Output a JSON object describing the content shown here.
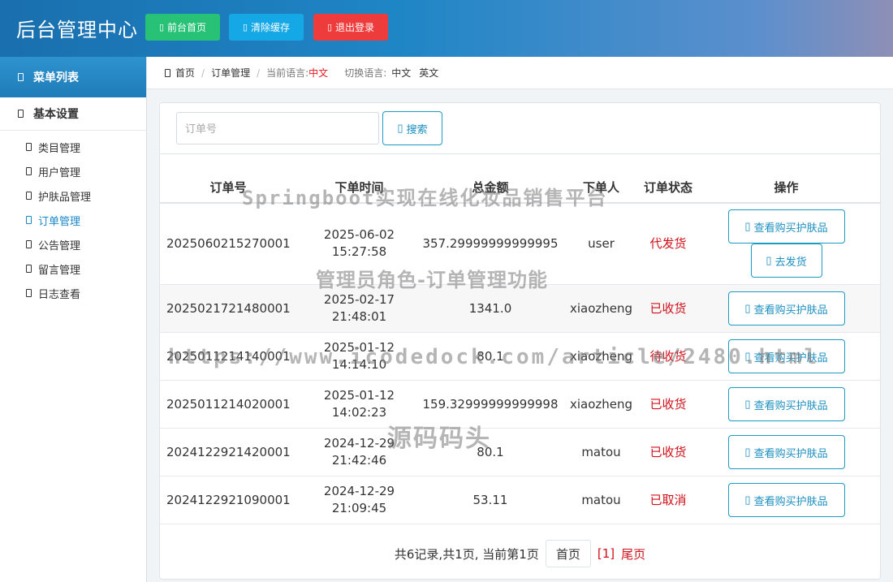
{
  "header": {
    "title": "后台管理中心",
    "buttons": {
      "home": "前台首页",
      "clear_cache": "清除缓存",
      "logout": "退出登录"
    }
  },
  "sidebar": {
    "menu_title": "菜单列表",
    "group_title": "基本设置",
    "items": [
      {
        "label": "类目管理",
        "active": false
      },
      {
        "label": "用户管理",
        "active": false
      },
      {
        "label": "护肤品管理",
        "active": false
      },
      {
        "label": "订单管理",
        "active": true
      },
      {
        "label": "公告管理",
        "active": false
      },
      {
        "label": "留言管理",
        "active": false
      },
      {
        "label": "日志查看",
        "active": false
      }
    ]
  },
  "breadcrumb": {
    "home": "首页",
    "current": "订单管理",
    "current_lang_label": "当前语言:",
    "current_lang": "中文",
    "switch_lang_label": "切换语言:",
    "lang_zh": "中文",
    "lang_en": "英文"
  },
  "search": {
    "placeholder": "订单号",
    "value": "",
    "button": "搜索"
  },
  "table": {
    "headers": [
      "订单号",
      "下单时间",
      "总金额",
      "下单人",
      "订单状态",
      "操作"
    ],
    "action_view": "查看购买护肤品",
    "action_ship": "去发货",
    "rows": [
      {
        "order_no": "2025060215270001",
        "date": "2025-06-02",
        "time": "15:27:58",
        "amount": "357.29999999999995",
        "user": "user",
        "status": "代发货"
      },
      {
        "order_no": "2025021721480001",
        "date": "2025-02-17",
        "time": "21:48:01",
        "amount": "1341.0",
        "user": "xiaozheng",
        "status": "已收货"
      },
      {
        "order_no": "2025011214140001",
        "date": "2025-01-12",
        "time": "14:14:10",
        "amount": "80.1",
        "user": "xiaozheng",
        "status": "待收货"
      },
      {
        "order_no": "2025011214020001",
        "date": "2025-01-12",
        "time": "14:02:23",
        "amount": "159.32999999999998",
        "user": "xiaozheng",
        "status": "已收货"
      },
      {
        "order_no": "2024122921420001",
        "date": "2024-12-29",
        "time": "21:42:46",
        "amount": "80.1",
        "user": "matou",
        "status": "已收货"
      },
      {
        "order_no": "2024122921090001",
        "date": "2024-12-29",
        "time": "21:09:45",
        "amount": "53.11",
        "user": "matou",
        "status": "已取消"
      }
    ]
  },
  "pager": {
    "summary": "共6记录,共1页, 当前第1页",
    "first": "首页",
    "current": "[1]",
    "last": "尾页"
  },
  "watermarks": {
    "line1": "Springboot实现在线化妆品销售平台",
    "line2": "管理员角色-订单管理功能",
    "line3": "https://www.icodedock.com/article/2480.html",
    "line4": "源码码头"
  },
  "colors": {
    "accent": "#1c8fc0",
    "danger": "#d0111b",
    "home_btn": "#27c276",
    "cache_btn": "#15a8e6",
    "logout_btn": "#ee3b3b"
  }
}
